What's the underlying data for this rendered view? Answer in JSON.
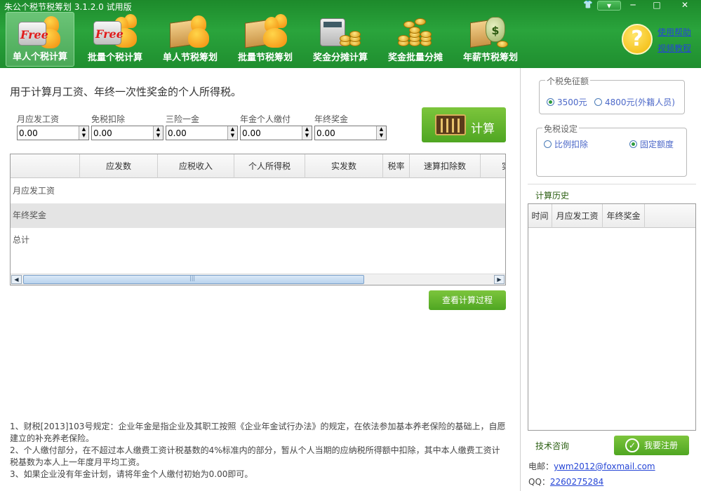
{
  "window": {
    "title": "朱公个税节税筹划 3.1.2.0 试用版",
    "controls": {
      "skin": "👕",
      "menu": "▾",
      "minimize": "─",
      "maximize": "□",
      "close": "✕"
    }
  },
  "nav": [
    {
      "label": "单人个税计算",
      "icon": "free-calculator-person-icon",
      "badge": "Free",
      "active": true
    },
    {
      "label": "批量个税计算",
      "icon": "free-calculator-group-icon",
      "badge": "Free",
      "active": false
    },
    {
      "label": "单人节税筹划",
      "icon": "book-person-icon",
      "active": false
    },
    {
      "label": "批量节税筹划",
      "icon": "book-group-icon",
      "active": false
    },
    {
      "label": "奖金分摊计算",
      "icon": "calculator-coins-icon",
      "active": false
    },
    {
      "label": "奖金批量分摊",
      "icon": "coin-stacks-icon",
      "active": false
    },
    {
      "label": "年薪节税筹划",
      "icon": "money-bag-book-icon",
      "bag_symbol": "$",
      "active": false
    }
  ],
  "help": {
    "icon": "?",
    "link1": "使用帮助",
    "link2": "视频教程"
  },
  "main": {
    "description": "用于计算月工资、年终一次性奖金的个人所得税。",
    "fields": [
      {
        "label": "月应发工资",
        "value": "0.00"
      },
      {
        "label": "免税扣除",
        "value": "0.00"
      },
      {
        "label": "三险一金",
        "value": "0.00"
      },
      {
        "label": "年金个人缴付",
        "value": "0.00"
      },
      {
        "label": "年终奖金",
        "value": "0.00"
      }
    ],
    "calc_button": "计算",
    "table": {
      "columns": [
        "",
        "应发数",
        "应税收入",
        "个人所得税",
        "实发数",
        "税率",
        "速算扣除数",
        "实"
      ],
      "rows": [
        "月应发工资",
        "年终奖金",
        "总计"
      ]
    },
    "scroll_glyph": "|||",
    "process_button": "查看计算过程",
    "notes": [
      "1、财税[2013]103号规定：企业年金是指企业及其职工按照《企业年金试行办法》的规定，在依法参加基本养老保险的基础上，自愿建立的补充养老保险。",
      "2、个人缴付部分，在不超过本人缴费工资计税基数的4%标准内的部分，暂从个人当期的应纳税所得额中扣除，其中本人缴费工资计税基数为本人上一年度月平均工资。",
      "3、如果企业没有年金计划，请将年金个人缴付初始为0.00即可。"
    ]
  },
  "sidebar": {
    "threshold": {
      "title": "个税免征额",
      "options": [
        "3500元",
        "4800元(外籍人员)"
      ],
      "selected": 0
    },
    "exemption": {
      "title": "免税设定",
      "options": [
        "比例扣除",
        "固定额度"
      ],
      "selected": 1
    },
    "history": {
      "title": "计算历史",
      "columns": [
        "时间",
        "月应发工资",
        "年终奖金"
      ]
    },
    "tech_support": "技术咨询",
    "register_button": "我要注册",
    "email_label": "电邮：",
    "email": "ywm2012@foxmail.com",
    "qq_label": "QQ：",
    "qq": "2260275284"
  },
  "colors": {
    "brand_green": "#2aa43c",
    "button_green": "#5fb22c",
    "link_blue": "#2545d6"
  }
}
